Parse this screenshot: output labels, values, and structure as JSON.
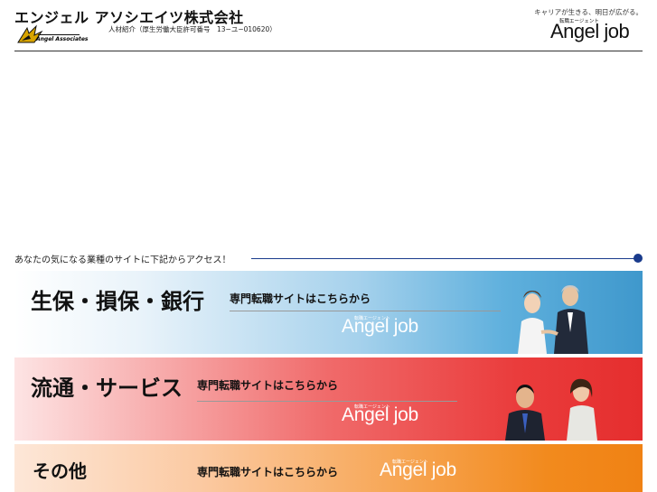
{
  "header": {
    "company_name": "エンジェル アソシエイツ株式会社",
    "license": "人材紹介（厚生労働大臣許可番号　13−ユ−010620）",
    "logo_text": "Angel Associates",
    "tagline": "キャリアが生きる、明日が広がる。",
    "brand_small": "転職エージェント",
    "brand_big": "Angel job"
  },
  "prompt": {
    "text": "あなたの気になる業種のサイトに下記からアクセス！"
  },
  "banners": [
    {
      "title": "生保・損保・銀行",
      "subtitle": "専門転職サイトはこちらから",
      "brand_small": "転職エージェント",
      "brand_big": "Angel job"
    },
    {
      "title": "流通・サービス",
      "subtitle": "専門転職サイトはこちらから",
      "brand_small": "転職エージェント",
      "brand_big": "Angel job"
    },
    {
      "title": "その他",
      "subtitle": "専門転職サイトはこちらから",
      "brand_small": "転職エージェント",
      "brand_big": "Angel job"
    }
  ],
  "colors": {
    "accent": "#1a3b8c",
    "banner1": "#3f98cc",
    "banner2": "#e52e2e",
    "banner3": "#f08214"
  }
}
